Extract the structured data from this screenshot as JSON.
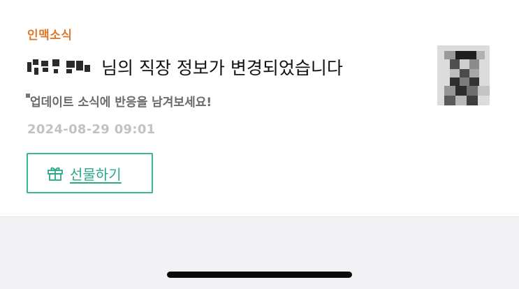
{
  "notification": {
    "category": "인맥소식",
    "title_text": "님의 직장 정보가 변경되었습니다",
    "subtitle": "업데이트 소식에 반응을 남겨보세요!",
    "timestamp": "2024-08-29 09:01",
    "gift_button_label": "선물하기",
    "gift_icon": "gift-icon",
    "avatar_icon": "pixelated-profile-photo"
  },
  "colors": {
    "category": "#e0782a",
    "accent": "#35b89a",
    "timestamp": "#c2c2c2",
    "footer_bg": "#f2f2f4"
  }
}
